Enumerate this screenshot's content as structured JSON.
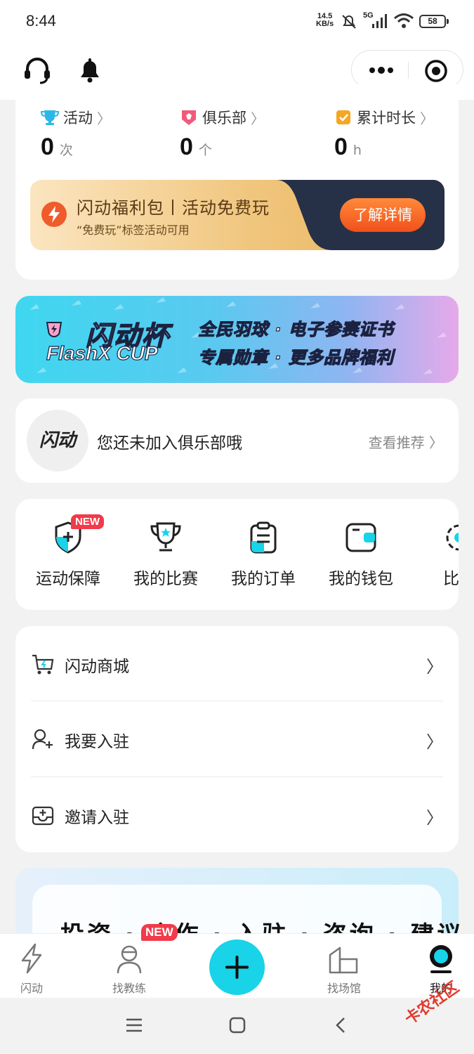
{
  "status_bar": {
    "time": "8:44",
    "speed_value": "14.5",
    "speed_unit": "KB/s",
    "network": "5G",
    "battery": "58"
  },
  "stats": [
    {
      "label": "活动",
      "value": "0",
      "unit": "次",
      "icon": "trophy-icon"
    },
    {
      "label": "俱乐部",
      "value": "0",
      "unit": "个",
      "icon": "club-badge-icon"
    },
    {
      "label": "累计时长",
      "value": "0",
      "unit": "h",
      "icon": "checkbox-icon"
    }
  ],
  "promo": {
    "title": "闪动福利包丨活动免费玩",
    "subtitle": "“免费玩”标签活动可用",
    "cta": "了解详情"
  },
  "banner": {
    "cup_title": "闪动杯",
    "cup_en": "FlashX CUP",
    "line1": "全民羽球 · 电子参赛证书",
    "line2": "专属勋章 · 更多品牌福利"
  },
  "club": {
    "logo_text": "闪动",
    "text": "您还未加入俱乐部哦",
    "more": "查看推荐 〉"
  },
  "grid": [
    {
      "label": "运动保障",
      "icon": "shield-plus-icon",
      "badge": "NEW"
    },
    {
      "label": "我的比赛",
      "icon": "trophy-icon"
    },
    {
      "label": "我的订单",
      "icon": "clipboard-icon"
    },
    {
      "label": "我的钱包",
      "icon": "wallet-icon"
    },
    {
      "label": "比赛",
      "icon": "gear-icon"
    }
  ],
  "menu": [
    {
      "label": "闪动商城",
      "icon": "cart-icon"
    },
    {
      "label": "我要入驻",
      "icon": "user-add-icon"
    },
    {
      "label": "邀请入驻",
      "icon": "inbox-plus-icon"
    }
  ],
  "bottom_card": {
    "slogan": "投资 · 合作 · 入驻 · 咨询 · 建议"
  },
  "tabs": [
    {
      "label": "闪动",
      "icon": "lightning-icon"
    },
    {
      "label": "找教练",
      "icon": "coach-icon",
      "badge": "NEW"
    },
    {
      "label": "找场馆",
      "icon": "venue-icon"
    },
    {
      "label": "我的",
      "icon": "profile-icon",
      "active": true
    }
  ],
  "watermark": "卡农社区",
  "colors": {
    "accent": "#19d3e8",
    "cta_orange": "#f1501b",
    "new_badge": "#f13a4a",
    "promo_dark": "#263147"
  }
}
